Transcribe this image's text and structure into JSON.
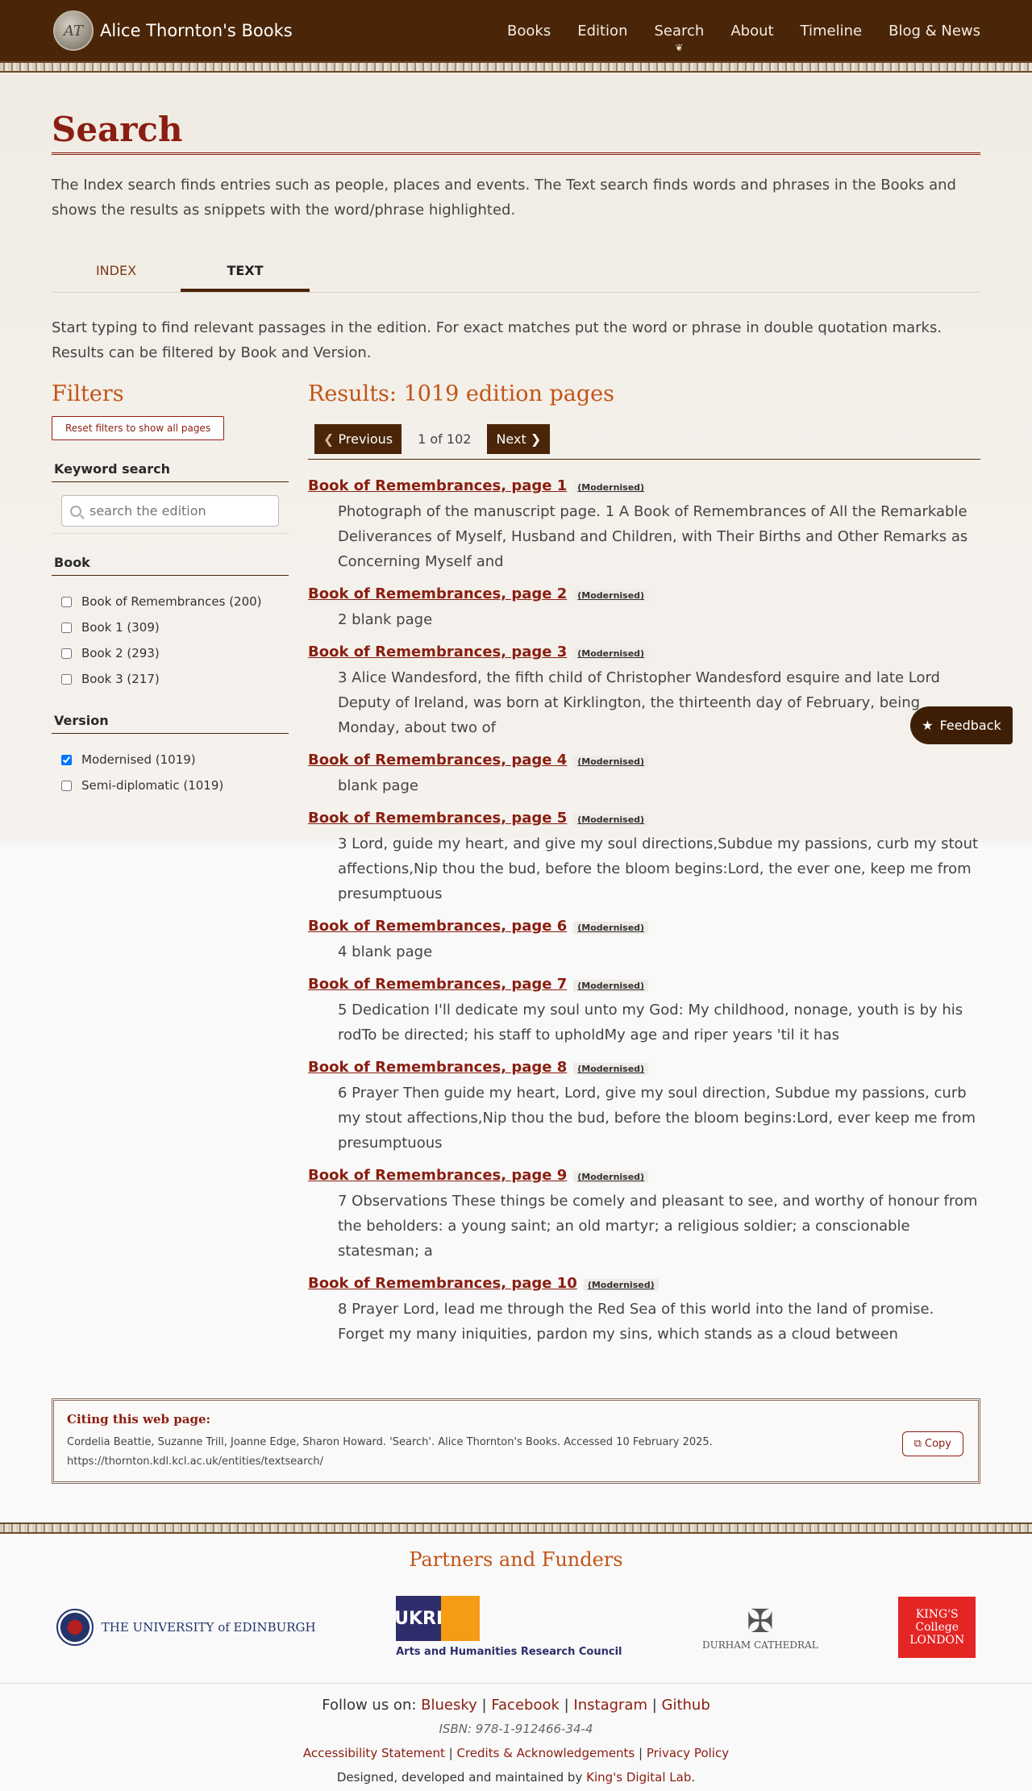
{
  "header": {
    "brand_title": "Alice Thornton's Books",
    "nav": [
      "Books",
      "Edition",
      "Search",
      "About",
      "Timeline",
      "Blog & News"
    ]
  },
  "page": {
    "title": "Search",
    "intro": "The Index search finds entries such as people, places and events. The Text search finds words and phrases in the Books and shows the results as snippets with the word/phrase highlighted.",
    "tabs": [
      "INDEX",
      "TEXT"
    ],
    "instructions": "Start typing to find relevant passages in the edition. For exact matches put the word or phrase in double quotation marks. Results can be filtered by Book and Version."
  },
  "filters": {
    "title": "Filters",
    "reset_label": "Reset filters to show all pages",
    "keyword_heading": "Keyword search",
    "search_placeholder": "search the edition",
    "book_heading": "Book",
    "books": [
      "Book of Remembrances (200)",
      "Book 1 (309)",
      "Book 2 (293)",
      "Book 3 (217)"
    ],
    "version_heading": "Version",
    "versions": [
      "Modernised (1019)",
      "Semi-diplomatic (1019)"
    ]
  },
  "results": {
    "heading": "Results: 1019 edition pages",
    "prev_label": "Previous",
    "next_label": "Next",
    "page_info": "1 of 102",
    "badge": "(Modernised)",
    "items": [
      {
        "title": "Book of Remembrances, page 1",
        "snippet": "Photograph of the manuscript page. 1 A Book of Remembrances of All the Remarkable Deliverances of Myself, Husband and Children, with Their Births and Other Remarks as Concerning Myself and"
      },
      {
        "title": "Book of Remembrances, page 2",
        "snippet": "2 blank page"
      },
      {
        "title": "Book of Remembrances, page 3",
        "snippet": "3 Alice Wandesford, the fifth child of Christopher Wandesford esquire and late Lord Deputy of Ireland, was born at Kirklington, the thirteenth day of February, being Monday, about two of"
      },
      {
        "title": "Book of Remembrances, page 4",
        "snippet": "blank page"
      },
      {
        "title": "Book of Remembrances, page 5",
        "snippet": "3 Lord, guide my heart, and give my soul directions,Subdue my passions, curb my stout affections,Nip thou the bud, before the bloom begins:Lord, the ever one, keep me from presumptuous"
      },
      {
        "title": "Book of Remembrances, page 6",
        "snippet": "4 blank page"
      },
      {
        "title": "Book of Remembrances, page 7",
        "snippet": "5 Dedication I'll dedicate my soul unto my God: My childhood, nonage, youth is by his rodTo be directed; his staff to upholdMy age and riper years 'til it has"
      },
      {
        "title": "Book of Remembrances, page 8",
        "snippet": "6 Prayer Then guide my heart, Lord, give my soul direction, Subdue my passions, curb my stout affections,Nip thou the bud, before the bloom begins:Lord, ever keep me from presumptuous"
      },
      {
        "title": "Book of Remembrances, page 9",
        "snippet": "7 Observations These things be comely and pleasant to see, and worthy of honour from the beholders: a young saint; an old martyr; a religious soldier; a conscionable statesman; a"
      },
      {
        "title": "Book of Remembrances, page 10",
        "snippet": "8 Prayer Lord, lead me through the Red Sea of this world into the land of promise. Forget my many iniquities, pardon my sins, which stands as a cloud between"
      }
    ]
  },
  "feedback_label": "Feedback",
  "citation": {
    "heading": "Citing this web page:",
    "text": "Cordelia Beattie, Suzanne Trill, Joanne Edge, Sharon Howard. 'Search'. Alice Thornton's Books. Accessed 10 February 2025. https://thornton.kdl.kcl.ac.uk/entities/textsearch/",
    "copy_label": "Copy"
  },
  "footer": {
    "partners_heading": "Partners and Funders",
    "partner_edinburgh": "THE UNIVERSITY of EDINBURGH",
    "partner_ukri": "Arts and Humanities Research Council",
    "partner_ukri_mark": "UKRI",
    "partner_durham": "DURHAM CATHEDRAL",
    "partner_kings": "KING'S College LONDON",
    "follow_prefix": "Follow us on:",
    "social": [
      "Bluesky",
      "Facebook",
      "Instagram",
      "Github"
    ],
    "isbn": "ISBN: 978-1-912466-34-4",
    "links": [
      "Accessibility Statement",
      "Credits & Acknowledgements",
      "Privacy Policy"
    ],
    "credit_prefix": "Designed, developed and maintained by",
    "credit_link": "King's Digital Lab"
  }
}
